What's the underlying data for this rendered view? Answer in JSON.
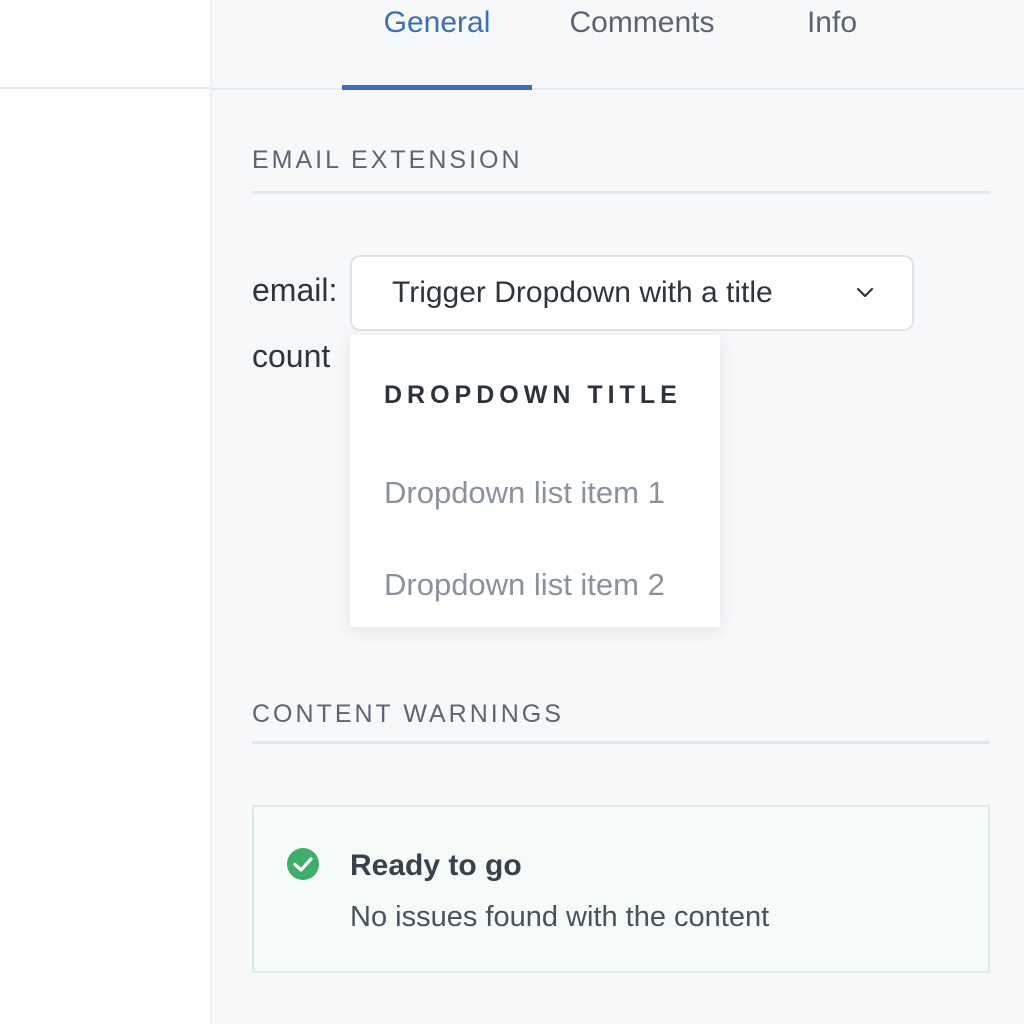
{
  "tabs": [
    {
      "label": "General",
      "active": true
    },
    {
      "label": "Comments",
      "active": false
    },
    {
      "label": "Info",
      "active": false
    }
  ],
  "email_extension": {
    "heading": "EMAIL EXTENSION",
    "email_label": "email:",
    "count_label": "count",
    "dropdown": {
      "trigger_label": "Trigger Dropdown with a title",
      "icon": "chevron-down-icon",
      "title": "DROPDOWN TITLE",
      "items": [
        "Dropdown list item 1",
        "Dropdown list item 2"
      ]
    }
  },
  "content_warnings": {
    "heading": "CONTENT WARNINGS",
    "status_icon": "check-circle-icon",
    "status_color": "#3fae6b",
    "title": "Ready to go",
    "message": "No issues found with the content"
  },
  "colors": {
    "accent": "#3d6fb6",
    "success": "#3fae6b"
  }
}
